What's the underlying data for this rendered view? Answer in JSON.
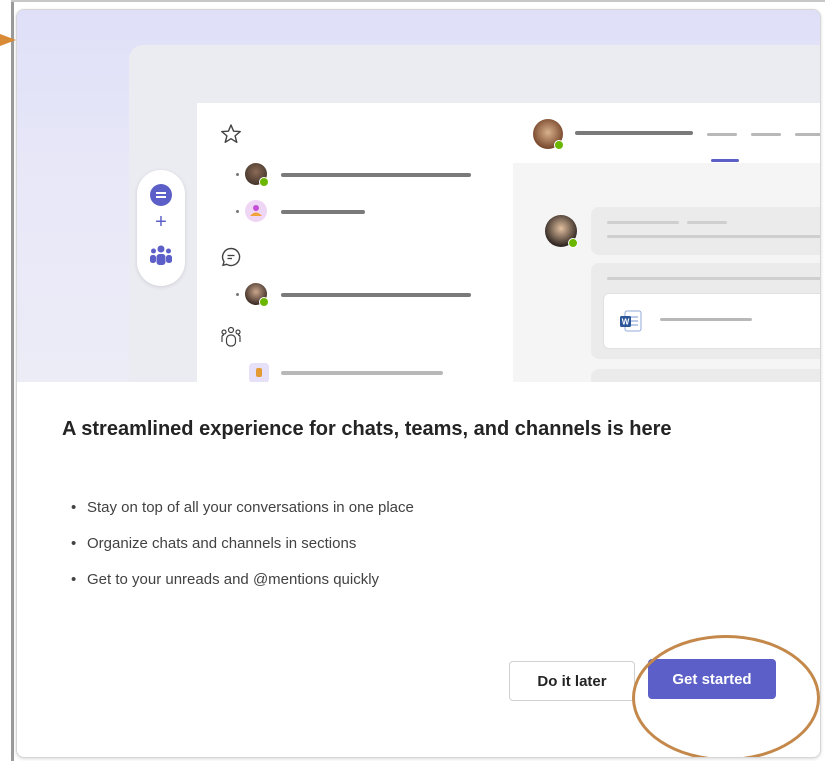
{
  "dialog": {
    "title": "A streamlined experience for chats, teams, and channels is here",
    "bullets": [
      "Stay on top of all your conversations in one place",
      "Organize chats and channels in sections",
      "Get to your unreads and @mentions quickly"
    ],
    "secondary_button": "Do it later",
    "primary_button": "Get started"
  },
  "colors": {
    "accent": "#5b5fc7",
    "annotation": "#c4884a",
    "online": "#6bb700"
  },
  "icons": {
    "favorites": "star-icon",
    "chats": "chat-icon",
    "teams": "teams-icon",
    "word": "word-doc-icon"
  }
}
